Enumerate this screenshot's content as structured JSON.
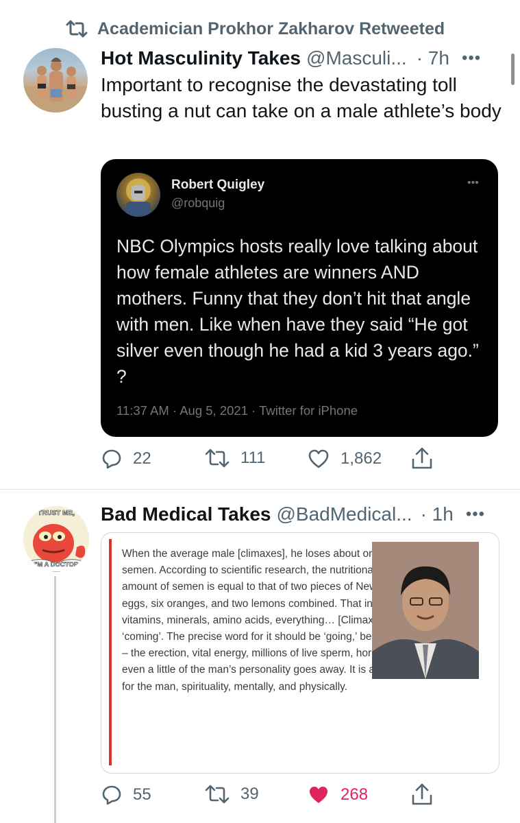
{
  "retweet_banner": {
    "text": "Academician Prokhor Zakharov Retweeted",
    "icon": "retweet-icon"
  },
  "tweet1": {
    "name": "Hot Masculinity Takes",
    "handle": "@Masculi...",
    "time": "· 7h",
    "more": "•••",
    "text": "Important to recognise the devastating toll busting a nut can take  on a male athlete’s body",
    "quote": {
      "name": "Robert Quigley",
      "handle": "@robquig",
      "more": "•••",
      "text": "NBC Olympics hosts really love talking about how female athletes are winners AND mothers. Funny that they don’t hit that angle with men. Like when have they said “He got silver even though he had a kid 3 years ago.” ?",
      "meta": "11:37 AM · Aug 5, 2021 · Twitter for iPhone"
    },
    "actions": {
      "replies": "22",
      "retweets": "111",
      "likes": "1,862"
    }
  },
  "tweet2": {
    "name": "Bad Medical Takes",
    "handle": "@BadMedical...",
    "time": "· 1h",
    "more": "•••",
    "avatar_text": {
      "top": "TRUST ME,",
      "bottom": "I'M A DOCTOR"
    },
    "image_excerpt": "When the average male [climaxes], he loses about one tablespoon of semen. According to scientific research, the nutritional value of this amount of semen is equal to that of two pieces of New York steak, ten eggs, six oranges, and two lemons combined. That includes proteins, vitamins, minerals, amino acids, everything… [Climax] is often called ‘coming’. The precise word for it should be ‘going,’ because everything – the erection, vital energy, millions of live sperm, hormones, nutrients, even a little of the man’s personality goes away. It is a great sacrifice for the man, spirituality, mentally, and physically.",
    "actions": {
      "replies": "55",
      "retweets": "39",
      "likes": "268",
      "liked": true
    }
  },
  "colors": {
    "text": "#0f1419",
    "muted": "#536471",
    "like_red": "#e0245e",
    "quote_bg": "#000000",
    "excerpt_bar": "#d9332f"
  }
}
